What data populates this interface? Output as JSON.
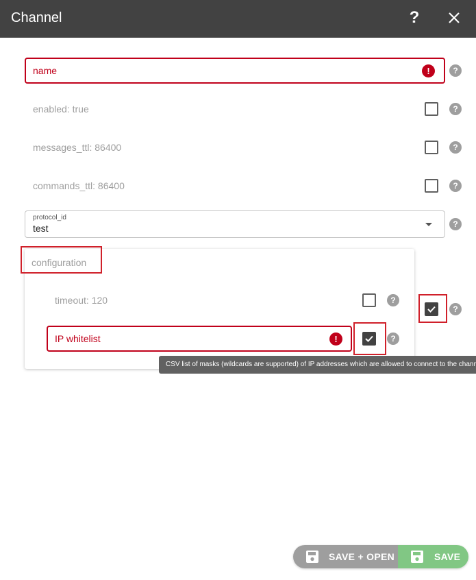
{
  "dialog": {
    "title": "Channel",
    "help_icon": "?",
    "close_icon": "close-icon"
  },
  "fields": {
    "name": {
      "label": "name",
      "error_mark": "!"
    },
    "enabled": {
      "label": "enabled: true",
      "checked": false
    },
    "messages_ttl": {
      "label": "messages_ttl: 86400",
      "checked": false
    },
    "commands_ttl": {
      "label": "commands_ttl: 86400",
      "checked": false
    },
    "protocol_id": {
      "label": "protocol_id",
      "value": "test"
    },
    "configuration": {
      "label": "configuration",
      "checked": true,
      "timeout": {
        "label": "timeout: 120",
        "checked": false
      },
      "ip_whitelist": {
        "label": "IP whitelist",
        "error_mark": "!",
        "checked": true
      }
    }
  },
  "help_mark": "?",
  "tooltip": {
    "text": "CSV list of masks (wildcards are supported) of IP addresses which are allowed to connect to the chann"
  },
  "actions": {
    "save_open_label": "SAVE + OPEN",
    "save_label": "SAVE"
  },
  "colors": {
    "titlebar": "#424242",
    "error": "#c0001a",
    "save": "#81c784",
    "save_open": "#9e9e9e"
  }
}
